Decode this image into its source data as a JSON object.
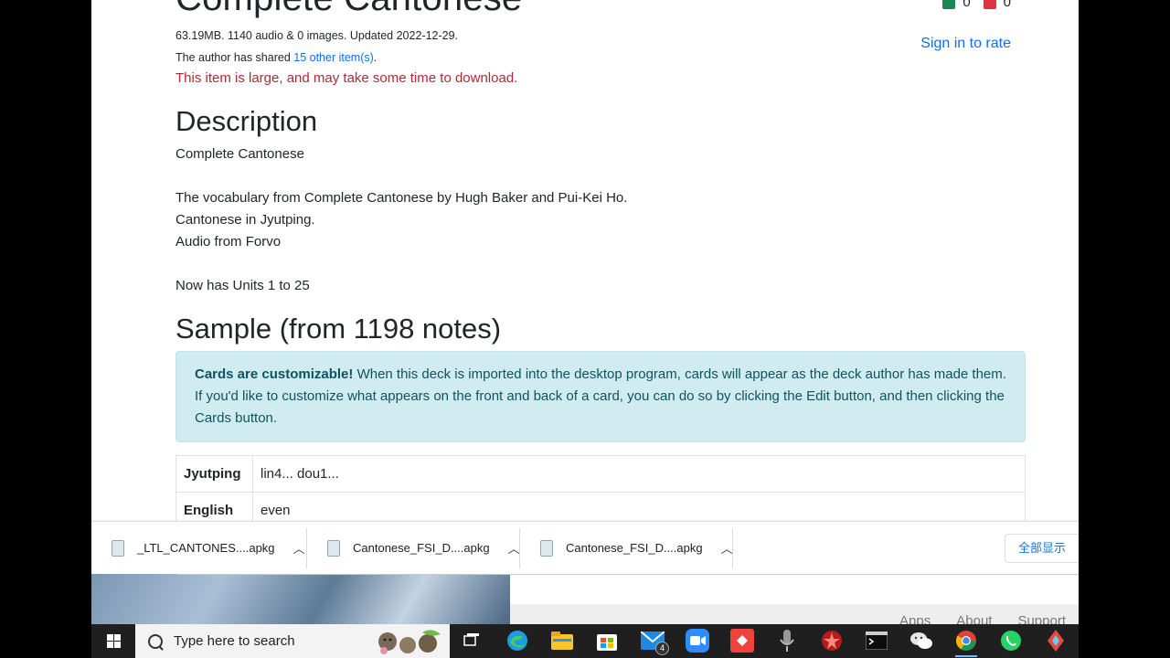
{
  "deck": {
    "title": "Complete Cantonese",
    "stats": "63.19MB. 1140 audio & 0 images. Updated 2022-12-29.",
    "shared_prefix": "The author has shared ",
    "shared_link": "15 other item(s)",
    "shared_suffix": ".",
    "warning": "This item is large, and may take some time to download."
  },
  "rating": {
    "up_count": "0",
    "down_count": "0",
    "sign_in": "Sign in to rate",
    "up_color": "#198754",
    "down_color": "#dc3545"
  },
  "description": {
    "heading": "Description",
    "lines": [
      "Complete Cantonese",
      "",
      "The vocabulary from Complete Cantonese by Hugh Baker and Pui-Kei Ho.",
      "Cantonese in Jyutping.",
      "Audio from Forvo",
      "",
      "Now has Units 1 to 25"
    ]
  },
  "sample": {
    "heading": "Sample (from 1198 notes)",
    "alert_bold": "Cards are customizable!",
    "alert_text": " When this deck is imported into the desktop program, cards will appear as the deck author has made them. If you'd like to customize what appears on the front and back of a card, you can do so by clicking the Edit button, and then clicking the Cards button.",
    "rows": [
      {
        "field": "Jyutping",
        "value": "lin4... dou1..."
      },
      {
        "field": "English",
        "value": "even"
      }
    ]
  },
  "downloads": {
    "items": [
      {
        "name": "_LTL_CANTONES....apkg",
        "icon": "apkg-file-icon"
      },
      {
        "name": "Cantonese_FSI_D....apkg",
        "icon": "apkg-file-icon"
      },
      {
        "name": "Cantonese_FSI_D....apkg",
        "icon": "apkg-file-icon"
      }
    ],
    "show_all": "全部显示"
  },
  "footer": {
    "links": [
      "Apps",
      "About",
      "Support"
    ]
  },
  "taskbar": {
    "search_placeholder": "Type here to search",
    "mail_badge": "4",
    "icons": [
      "task-view-icon",
      "edge-icon",
      "file-explorer-icon",
      "store-icon",
      "mail-icon",
      "zoom-icon",
      "anydesk-icon",
      "microphone-icon",
      "anki-icon",
      "terminal-icon",
      "wechat-icon",
      "chrome-icon",
      "whatsapp-icon",
      "app-icon"
    ]
  }
}
